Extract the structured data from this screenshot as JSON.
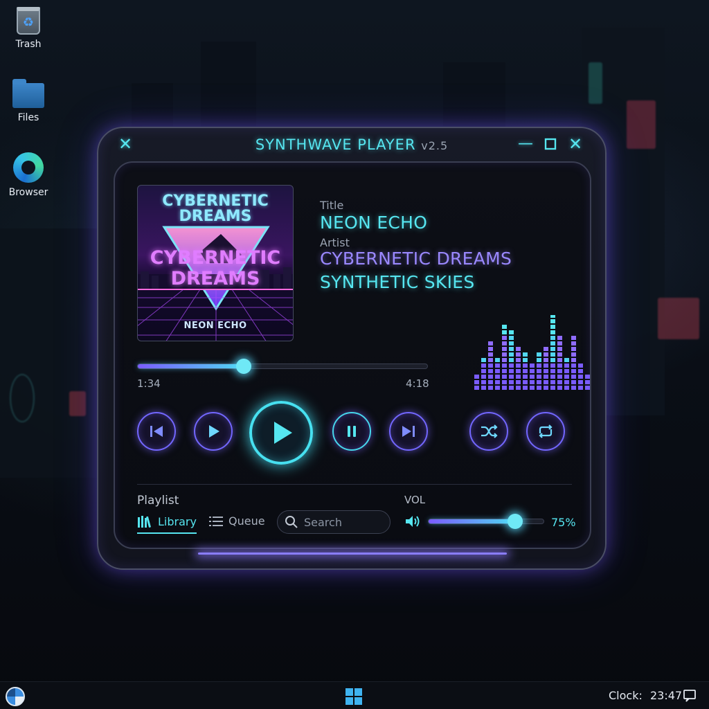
{
  "desktop": {
    "icons": [
      {
        "label": "Trash"
      },
      {
        "label": "Files"
      },
      {
        "label": "Browser"
      }
    ]
  },
  "window": {
    "title": "SYNTHWAVE PLAYER",
    "version": "v2.5"
  },
  "album_art": {
    "top_text": "CYBERNETIC\nDREAMS",
    "center_text": "CYBERNETIC\nDREAMS",
    "bottom_text": "NEON ECHO"
  },
  "track": {
    "title_label": "Title",
    "title": "NEON ECHO",
    "artist_label": "Artist",
    "artist": "CYBERNETIC DREAMS",
    "album": "SYNTHETIC SKIES"
  },
  "progress": {
    "elapsed": "1:34",
    "total": "4:18",
    "fraction": 0.365
  },
  "equalizer": {
    "levels": [
      0.25,
      0.4,
      0.65,
      0.45,
      0.9,
      0.8,
      0.55,
      0.5,
      0.35,
      0.5,
      0.6,
      1.0,
      0.7,
      0.45,
      0.75,
      0.35,
      0.2
    ]
  },
  "controls": {
    "prev": "skip-back-icon",
    "play_small": "play-icon",
    "play_main": "play-icon",
    "pause": "pause-icon",
    "next": "skip-forward-icon",
    "shuffle": "shuffle-icon",
    "repeat": "repeat-icon"
  },
  "bottom": {
    "playlist_label": "Playlist",
    "tab_library": "Library",
    "tab_queue": "Queue",
    "search_placeholder": "Search",
    "vol_label": "VOL",
    "volume_percent": "75%",
    "volume_fraction": 0.75
  },
  "taskbar": {
    "clock_label": "Clock:",
    "clock_time": "23:47"
  },
  "colors": {
    "cyan": "#56e6f0",
    "violet": "#8a7dff",
    "magenta": "#d977ff"
  }
}
